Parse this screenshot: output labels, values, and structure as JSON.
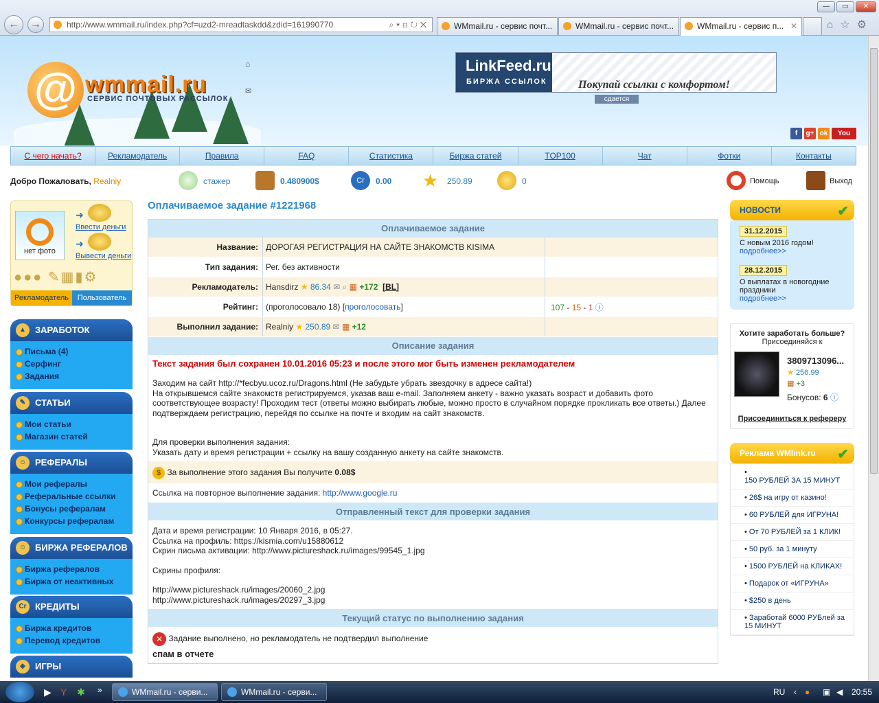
{
  "browser": {
    "url": "http://www.wmmail.ru/index.php?cf=uzd2-mreadtaskdd&zdid=161990770",
    "tabs": [
      "WMmail.ru - сервис почт...",
      "WMmail.ru - сервис почт...",
      "WMmail.ru - сервис п..."
    ],
    "back_icon": "back-arrow-icon",
    "forward_icon": "forward-arrow-icon"
  },
  "header": {
    "logo_text": "wmmail.ru",
    "logo_sub": "СЕРВИС ПОЧТОВЫХ РАССЫЛОК",
    "banner_title": "LinkFeed.ru",
    "banner_sub": "БИРЖА ССЫЛОК",
    "banner_slogan": "Покупай ссылки с комфортом!",
    "banner_rent": "сдается"
  },
  "menu": [
    "С чего начать?",
    "Рекламодатель",
    "Правила",
    "FAQ",
    "Статистика",
    "Биржа статей",
    "TOP100",
    "Чат",
    "Фотки",
    "Контакты"
  ],
  "userbar": {
    "welcome": "Добро Пожаловать,",
    "username": "Realniy",
    "rank": "стажер",
    "balance": "0.480900$",
    "credits": "0.00",
    "rating": "250.89",
    "coins": "0",
    "help": "Помощь",
    "logout": "Выход"
  },
  "profile": {
    "no_photo": "нет фото",
    "deposit": "Ввести деньги",
    "withdraw": "Вывести деньги",
    "tab_advertiser": "Рекламодатель",
    "tab_user": "Пользователь"
  },
  "sidebar": [
    {
      "title": "ЗАРАБОТОК",
      "items": [
        "Письма (4)",
        "Серфинг",
        "Задания"
      ]
    },
    {
      "title": "СТАТЬИ",
      "items": [
        "Мои статьи",
        "Магазин статей"
      ]
    },
    {
      "title": "РЕФЕРАЛЫ",
      "items": [
        "Мои рефералы",
        "Реферальные ссылки",
        "Бонусы рефералам",
        "Конкурсы рефералам"
      ]
    },
    {
      "title": "БИРЖА РЕФЕРАЛОВ",
      "items": [
        "Биржа рефералов",
        "Биржа от неактивных"
      ]
    },
    {
      "title": "КРЕДИТЫ",
      "items": [
        "Биржа кредитов",
        "Перевод кредитов"
      ]
    },
    {
      "title": "ИГРЫ",
      "items": []
    }
  ],
  "task": {
    "page_title": "Оплачиваемое задание #1221968",
    "sec_paid": "Оплачиваемое задание",
    "label_name": "Название:",
    "name": "ДОРОГАЯ РЕГИСТРАЦИЯ НА САЙТЕ ЗНАКОМСТВ KISIMA",
    "label_type": "Тип задания:",
    "type": "Рег. без активности",
    "label_adv": "Рекламодатель:",
    "adv_name": "Hansdirz",
    "adv_rating": "86.34",
    "adv_plus": "+172",
    "adv_bl": "[BL]",
    "label_rating": "Рейтинг:",
    "votes_text": "(проголосовало 18) [",
    "vote_link": "проголосовать",
    "votes_close": "]",
    "rate_good": "107",
    "rate_mid": "15",
    "rate_bad": "1",
    "label_done": "Выполнил задание:",
    "done_user": "Realniy",
    "done_rating": "250.89",
    "done_plus": "+12",
    "sec_desc": "Описание задания",
    "warning": "Текст задания был сохранен 10.01.2016 05:23 и после этого мог быть изменен рекламодателем",
    "desc_lines": [
      "Заходим на сайт http://*fecbyu.ucoz.ru/Dragons.html (Не забудьте убрать звездочку в адресе сайта!)",
      "На открывшемся сайте знакомств регистрируемся, указав ваш e-mail. Заполняем анкету - важно указать возраст и добавить фото соответствующее возрасту! Проходим тест (ответы можно выбирать любые, можно просто в случайном порядке прокликать все ответы.) Далее подтверждаем регистрацию, перейдя по ссылке на почте и входим на сайт знакомств."
    ],
    "check_title": "Для проверки выполнения задания:",
    "check_text": "Указать дату и время регистрации + ссылку на вашу созданную анкету на сайте знакомств.",
    "pay_text": "За выполнение этого задания Вы получите",
    "pay_amount": "0.08$",
    "repeat_label": "Ссылка на повторное выполнение задания:",
    "repeat_link": "http://www.google.ru",
    "sec_sent": "Отправленный текст для проверки задания",
    "sent_lines": [
      "Дата и время регистрации: 10 Января 2016, в 05:27.",
      "Ссылка на профиль: https://kismia.com/u15880612",
      "Скрин письма активации: http://www.pictureshack.ru/images/99545_1.jpg",
      "",
      "Скрины профиля:",
      "",
      "http://www.pictureshack.ru/images/20060_2.jpg",
      "http://www.pictureshack.ru/images/20297_3.jpg"
    ],
    "sec_status": "Текущий статус по выполнению задания",
    "status_text": "Задание выполнено, но рекламодатель не подтвердил выполнение",
    "status_reason": "спам в отчете"
  },
  "news": {
    "title": "НОВОСТИ",
    "items": [
      {
        "date": "31.12.2015",
        "text": "С новым 2016 годом!",
        "more": "подробнее>>"
      },
      {
        "date": "28.12.2015",
        "text": "О выплатах в новогодние праздники",
        "more": "подробнее>>"
      }
    ]
  },
  "earn": {
    "title": "Хотите заработать больше?",
    "sub": "Присоединяйся к",
    "ref_name": "3809713096...",
    "ref_rating": "256.99",
    "ref_plus": "+3",
    "bonus_label": "Бонусов:",
    "bonus_value": "6",
    "join": "Присоединиться к рефереру"
  },
  "ads": {
    "title": "Реклама WMlink.ru",
    "items": [
      "150 РУБЛЕЙ ЗА 15 МИНУТ",
      "26$ на игру от казино!",
      "60 РУБЛЕЙ для ИГРУНА!",
      "От 70 РУБЛЕЙ за 1 КЛИК!",
      "50 руб. за 1 минуту",
      "1500 РУБЛЕЙ на КЛИКАХ!",
      "Подарок от «ИГРУНА»",
      "$250 в день",
      "Заработай 6000 РУБлей за 15 МИНУТ"
    ]
  },
  "taskbar": {
    "items": [
      "WMmail.ru - серви...",
      "WMmail.ru - серви..."
    ],
    "lang": "RU",
    "time": "20:55"
  }
}
